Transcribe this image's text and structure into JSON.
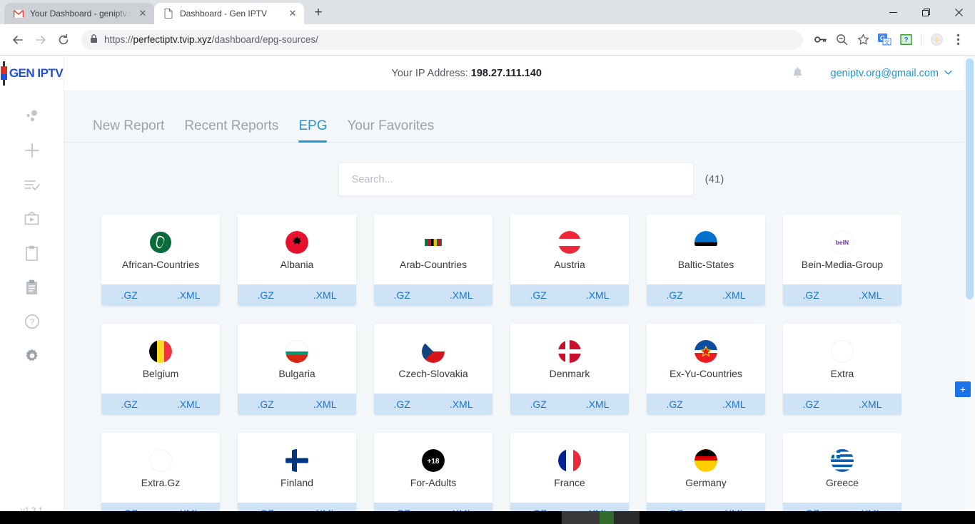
{
  "browser": {
    "tabs": [
      {
        "title": "Your Dashboard - geniptv.org@g",
        "favicon": "gmail-icon",
        "active": false
      },
      {
        "title": "Dashboard - Gen IPTV",
        "favicon": "page-icon",
        "active": true
      }
    ],
    "new_tab_label": "+",
    "window_controls": {
      "minimize": "—",
      "restore": "❐",
      "close": "✕"
    },
    "nav": {
      "back": "←",
      "forward": "→",
      "reload": "⟳"
    },
    "url": {
      "scheme": "https://",
      "host": "perfectiptv.tvip.xyz",
      "path": "/dashboard/epg-sources/",
      "lock_icon": "lock-icon"
    },
    "toolbar_icons": [
      "key-icon",
      "zoom-out-icon",
      "bookmark-star-icon",
      "translate-icon",
      "extension-icon",
      "profile-icon",
      "menu-icon"
    ]
  },
  "sidebar": {
    "logo_text": "GEN IPTV",
    "version": "v1.3.1",
    "items": [
      {
        "name": "dashboard-icon",
        "label": "Dashboard"
      },
      {
        "name": "plus-icon",
        "label": "New"
      },
      {
        "name": "list-check-icon",
        "label": "Tasks"
      },
      {
        "name": "tv-icon",
        "label": "Channels"
      },
      {
        "name": "clipboard-icon",
        "label": "Reports"
      },
      {
        "name": "clipboard-list-icon",
        "label": "Logs"
      },
      {
        "name": "help-icon",
        "label": "Help"
      },
      {
        "name": "gear-icon",
        "label": "Settings"
      }
    ]
  },
  "header": {
    "ip_label": "Your IP Address:",
    "ip_value": "198.27.111.140",
    "bell_icon": "notification-bell-icon",
    "user_email": "geniptv.org@gmail.com",
    "caret": "⌄"
  },
  "main": {
    "tabs": [
      {
        "label": "New Report",
        "active": false
      },
      {
        "label": "Recent Reports",
        "active": false
      },
      {
        "label": "EPG",
        "active": true
      },
      {
        "label": "Your Favorites",
        "active": false
      }
    ],
    "search": {
      "placeholder": "Search...",
      "value": ""
    },
    "count": "(41)",
    "gz_label": ".GZ",
    "xml_label": ".XML",
    "fab_label": "+",
    "sources": [
      {
        "name": "African-Countries",
        "flag": "africa-flag"
      },
      {
        "name": "Albania",
        "flag": "albania-flag"
      },
      {
        "name": "Arab-Countries",
        "flag": "arab-league-flag"
      },
      {
        "name": "Austria",
        "flag": "austria-flag"
      },
      {
        "name": "Baltic-States",
        "flag": "estonia-flag"
      },
      {
        "name": "Bein-Media-Group",
        "flag": "bein-logo"
      },
      {
        "name": "Belgium",
        "flag": "belgium-flag"
      },
      {
        "name": "Bulgaria",
        "flag": "bulgaria-flag"
      },
      {
        "name": "Czech-Slovakia",
        "flag": "czech-flag"
      },
      {
        "name": "Denmark",
        "flag": "denmark-flag"
      },
      {
        "name": "Ex-Yu-Countries",
        "flag": "yugoslavia-flag"
      },
      {
        "name": "Extra",
        "flag": "empty-flag"
      },
      {
        "name": "Extra.Gz",
        "flag": "empty-flag"
      },
      {
        "name": "Finland",
        "flag": "finland-flag"
      },
      {
        "name": "For-Adults",
        "flag": "adults-18-icon"
      },
      {
        "name": "France",
        "flag": "france-flag"
      },
      {
        "name": "Germany",
        "flag": "germany-flag"
      },
      {
        "name": "Greece",
        "flag": "greece-flag"
      }
    ]
  },
  "colors": {
    "accent": "#2196d6",
    "link": "#1d75c9",
    "footer_bg": "#cfe3f7",
    "fab": "#1a73e8"
  }
}
